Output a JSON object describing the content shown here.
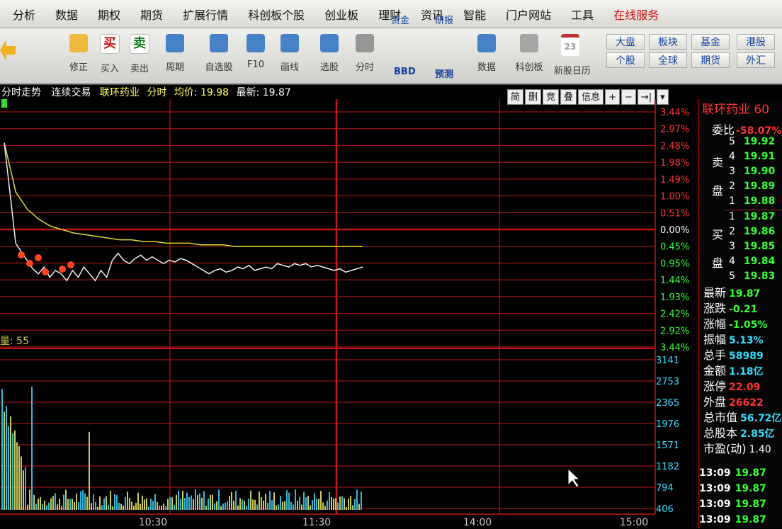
{
  "menu": [
    "分析",
    "数据",
    "期权",
    "期货",
    "扩展行情",
    "科创板个股",
    "创业板",
    "理财",
    "资讯",
    "智能",
    "门户网站",
    "工具",
    "在线服务"
  ],
  "toolbar": {
    "buttons": [
      {
        "label": "修正",
        "icon": "arrow-up-down-icon"
      },
      {
        "label": "买入",
        "icon": "buy-icon",
        "char": "买"
      },
      {
        "label": "卖出",
        "icon": "sell-icon",
        "char": "卖"
      },
      {
        "label": "周期",
        "icon": "clock-icon"
      },
      {
        "label": "自选股",
        "icon": "star-icon"
      },
      {
        "label": "F10",
        "icon": "f10-icon"
      },
      {
        "label": "画线",
        "icon": "pen-icon"
      },
      {
        "label": "选股",
        "icon": "screen-icon"
      },
      {
        "label": "分时",
        "icon": "intraday-icon"
      },
      {
        "label": "资金",
        "icon": "fund-icon"
      },
      {
        "label": "研报",
        "icon": "report-icon"
      },
      {
        "label": "数据",
        "icon": "data-icon"
      },
      {
        "label": "科创板",
        "icon": "star-board-icon"
      },
      {
        "label": "新股日历",
        "icon": "calendar-icon"
      }
    ],
    "side_buttons": [
      {
        "label": "大盘"
      },
      {
        "label": "板块"
      },
      {
        "label": "基金"
      },
      {
        "label": "港股"
      },
      {
        "label": "个股"
      },
      {
        "label": "全球"
      },
      {
        "label": "期货"
      },
      {
        "label": "外汇"
      }
    ],
    "extra": {
      "bbd": "BBD",
      "predict": "预测",
      "calendar_day": "23"
    }
  },
  "chart_header": {
    "view": "分时走势",
    "mode": "连续交易",
    "name": "联环药业",
    "type": "分时",
    "avg_label": "均价:",
    "avg": "19.98",
    "last_label": "最新:",
    "last": "19.87"
  },
  "chart_controls": [
    "简",
    "删",
    "竞",
    "叠",
    "信息",
    "+",
    "−",
    "→|",
    "▾"
  ],
  "chart_data": {
    "type": "line",
    "price_axis_labels": [
      "3.44%",
      "2.97%",
      "2.48%",
      "1.98%",
      "1.49%",
      "1.00%",
      "0.51%",
      "0.00%",
      "0.45%",
      "0.95%",
      "1.44%",
      "1.93%",
      "2.42%",
      "2.92%",
      "3.44%"
    ],
    "volume_label": "量: 55",
    "volume_axis_labels": [
      "3141",
      "2753",
      "2365",
      "1976",
      "1571",
      "1182",
      "794",
      "406"
    ],
    "time_labels": [
      "10:30",
      "11:30",
      "14:00",
      "15:00"
    ],
    "price_series": [
      20.59,
      20.3,
      20.0,
      19.95,
      19.9,
      19.85,
      19.82,
      19.86,
      19.8,
      19.84,
      19.82,
      19.78,
      19.84,
      19.8,
      19.86,
      19.82,
      19.78,
      19.84,
      19.8,
      19.9,
      19.94,
      19.9,
      19.88,
      19.91,
      19.93,
      19.9,
      19.92,
      19.9,
      19.88,
      19.9,
      19.89,
      19.91,
      19.9,
      19.88,
      19.86,
      19.84,
      19.82,
      19.84,
      19.85,
      19.83,
      19.84,
      19.86,
      19.85,
      19.87,
      19.84,
      19.85,
      19.86,
      19.85,
      19.88,
      19.87,
      19.86,
      19.88,
      19.87,
      19.88,
      19.86,
      19.87,
      19.86,
      19.85,
      19.84,
      19.85,
      19.83,
      19.84,
      19.85,
      19.86
    ],
    "avg_series": [
      20.59,
      20.3,
      20.2,
      20.14,
      20.1,
      20.08,
      20.06,
      20.05,
      20.04,
      20.03,
      20.02,
      20.02,
      20.01,
      20.01,
      20.0,
      20.0,
      20.0,
      19.99,
      19.99,
      19.99,
      19.98,
      19.98,
      19.98,
      19.98,
      19.98,
      19.98,
      19.98,
      19.98,
      19.98,
      19.98,
      19.98,
      19.98
    ]
  },
  "quote": {
    "title": "联环药业 60",
    "ratio_label": "委比",
    "ratio": "-58.07%",
    "sell_label": "卖盘",
    "buy_label": "买盘",
    "sell": [
      {
        "lv": "5",
        "price": "19.92"
      },
      {
        "lv": "4",
        "price": "19.91"
      },
      {
        "lv": "3",
        "price": "19.90"
      },
      {
        "lv": "2",
        "price": "19.89"
      },
      {
        "lv": "1",
        "price": "19.88"
      }
    ],
    "buy": [
      {
        "lv": "1",
        "price": "19.87"
      },
      {
        "lv": "2",
        "price": "19.86"
      },
      {
        "lv": "3",
        "price": "19.85"
      },
      {
        "lv": "4",
        "price": "19.84"
      },
      {
        "lv": "5",
        "price": "19.83"
      }
    ],
    "stats": [
      {
        "label": "最新",
        "value": "19.87",
        "cls": "g"
      },
      {
        "label": "涨跌",
        "value": "-0.21",
        "cls": "g"
      },
      {
        "label": "涨幅",
        "value": "-1.05%",
        "cls": "g"
      },
      {
        "label": "振幅",
        "value": "5.13%",
        "cls": "c"
      },
      {
        "label": "总手",
        "value": "58989",
        "cls": "c"
      },
      {
        "label": "金额",
        "value": "1.18亿",
        "cls": "c"
      },
      {
        "label": "涨停",
        "value": "22.09",
        "cls": "r"
      },
      {
        "label": "外盘",
        "value": "26622",
        "cls": "r"
      },
      {
        "label": "总市值",
        "value": "56.72亿",
        "cls": "c"
      },
      {
        "label": "总股本",
        "value": "2.85亿",
        "cls": "c"
      },
      {
        "label": "市盈(动)",
        "value": "1.40",
        "cls": "w"
      }
    ],
    "trades": [
      {
        "time": "13:09",
        "price": "19.87"
      },
      {
        "time": "13:09",
        "price": "19.87"
      },
      {
        "time": "13:09",
        "price": "19.87"
      },
      {
        "time": "13:09",
        "price": "19.87"
      }
    ]
  }
}
